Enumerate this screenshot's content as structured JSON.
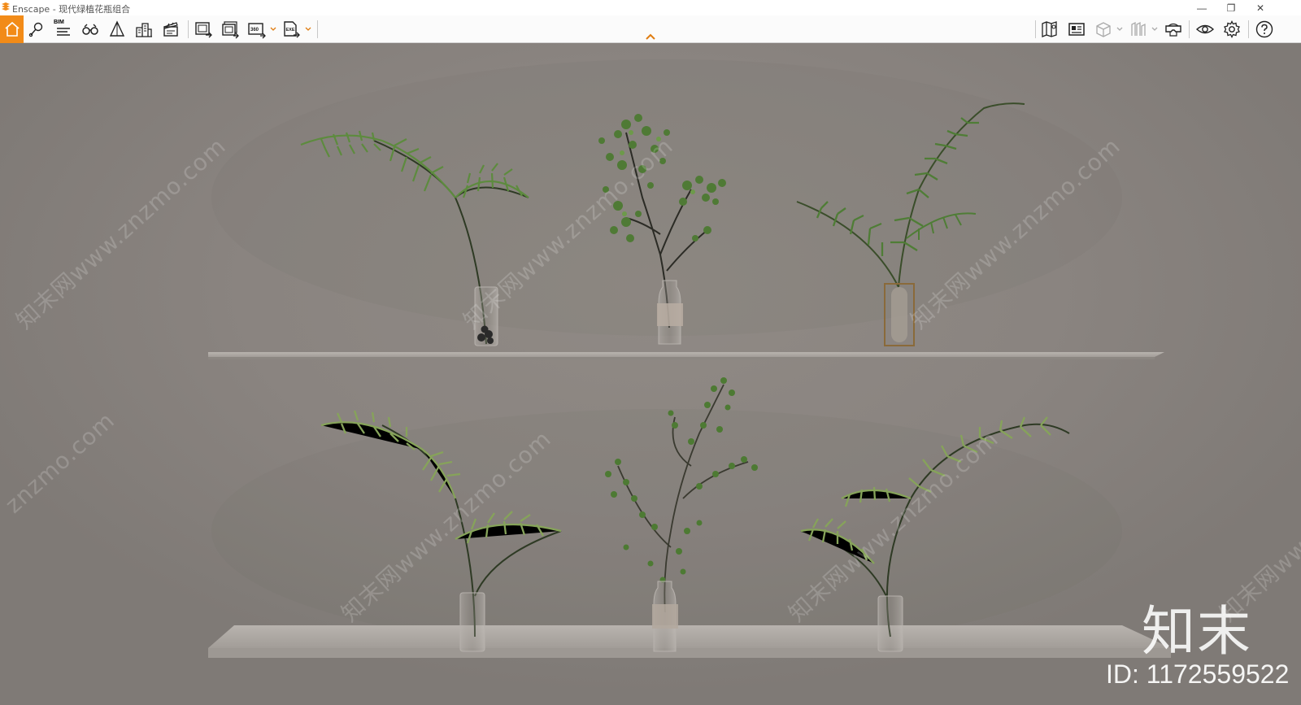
{
  "window": {
    "title": "Enscape - 现代绿植花瓶组合",
    "controls": {
      "minimize": "—",
      "restore": "❐",
      "close": "✕"
    }
  },
  "toolbar": {
    "bim_label": "BIM",
    "left_tools": [
      "home-icon",
      "location-pin-icon",
      "bim-info-icon",
      "binoculars-icon",
      "sketch-mode-icon",
      "buildings-icon",
      "clapperboard-icon",
      "screenshot-export-icon",
      "batch-render-icon",
      "panorama-360-icon",
      "exe-export-icon"
    ],
    "right_tools": [
      "map-icon",
      "asset-library-icon",
      "box-view-icon",
      "views-icon",
      "vr-headset-icon",
      "visibility-eye-icon",
      "settings-gear-icon",
      "help-icon"
    ],
    "accent_color": "#f28b18"
  },
  "watermark": {
    "site": "知末网www.znzmo.com",
    "site_partial": "znzmo.com",
    "brand": "知末",
    "id_text": "ID: 1172559522"
  },
  "scene": {
    "wall_color": "#8b8581",
    "shelf_color": "#b1aca7",
    "leaf_color": "#5a8a3a"
  }
}
